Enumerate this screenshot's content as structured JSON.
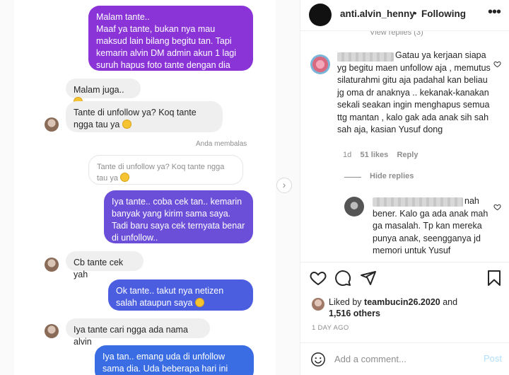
{
  "chat": {
    "messages": [
      {
        "type": "out",
        "text": "Malam tante..\nMaaf ya tante, bukan nya mau maksud lain bilang begitu tan. Tapi kemarin alvin DM admin akun 1 lagi suruh hapus foto tante dengan dia juga tan..",
        "color": "#8a33d6"
      },
      {
        "type": "in",
        "text": "Malam juga.."
      },
      {
        "type": "in",
        "text": "Tante di unfollow ya? Koq tante ngga tau ya"
      },
      {
        "type": "meta",
        "text": "Anda membalas"
      },
      {
        "type": "quote",
        "text": "Tante di unfollow ya? Koq tante ngga tau ya"
      },
      {
        "type": "out",
        "text": "Iya tante.. coba cek tan.. kemarin banyak yang kirim sama saya. Tadi baru saya cek ternyata benar di unfollow..",
        "color": "#6b4fd8"
      },
      {
        "type": "in",
        "text": "Cb tante cek yah"
      },
      {
        "type": "out",
        "text": "Ok tante.. takut nya netizen salah ataupun saya",
        "color": "#4b5ee0"
      },
      {
        "type": "in",
        "text": "Iya tante cari ngga ada nama alvin"
      },
      {
        "type": "out",
        "text": "Iya tan.. emang uda di unfollow sama dia. Uda beberapa hari ini netizen",
        "color": "#3a6de3"
      }
    ]
  },
  "post": {
    "username": "anti.alvin_henny",
    "separator": "•",
    "follow_status": "Following",
    "more_icon": "more-icon",
    "view_replies": "View replies (3)",
    "comment1": {
      "text": "Gatau ya kerjaan siapa yg begitu maen unfollow aja , memutus silaturahmi gitu aja padahal kan beliau jg oma dr anaknya .. kekanak-kanakan sekali seakan ingin menghapus semua ttg mantan , kalo gak ada anak sih sah sah aja, kasian Yusuf dong",
      "age": "1d",
      "likes": "51 likes",
      "reply": "Reply"
    },
    "hide_replies": "Hide replies",
    "reply1": {
      "text": "nah bener. Kalo ga ada anak mah ga masalah. Tp kan mereka punya anak, seengganya jd memori untuk Yusuf"
    },
    "liked_by_prefix": "Liked by",
    "liked_by_user": "teambucin26.2020",
    "liked_by_and": "and",
    "liked_by_others": "1,516 others",
    "time_ago": "1 DAY AGO",
    "add_comment_placeholder": "Add a comment...",
    "post_label": "Post"
  },
  "colors": {
    "accent": "#0095f6",
    "post_disabled": "#b2dffc",
    "muted": "#8e8e8e"
  }
}
